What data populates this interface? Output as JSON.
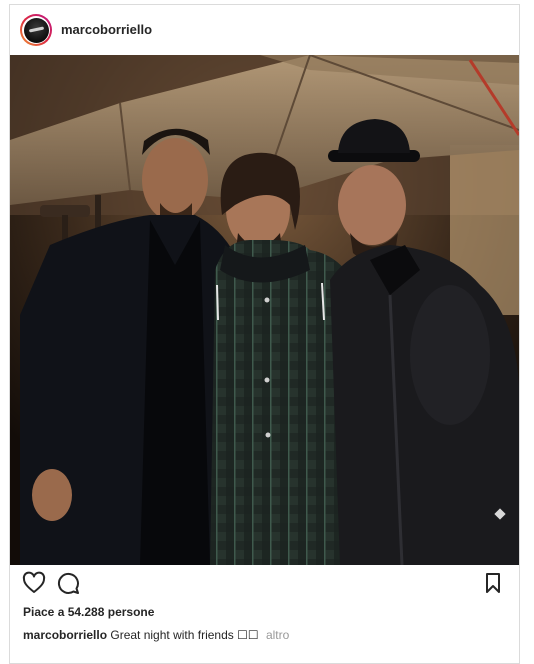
{
  "post": {
    "username": "marcoborriello",
    "likes_text": "Piace a 54.288 persone",
    "caption_user": "marcoborriello",
    "caption_text": "Great night with friends ☐☐",
    "more_label": "altro"
  },
  "icons": {
    "like": "heart-icon",
    "comment": "comment-icon",
    "save": "bookmark-icon"
  }
}
